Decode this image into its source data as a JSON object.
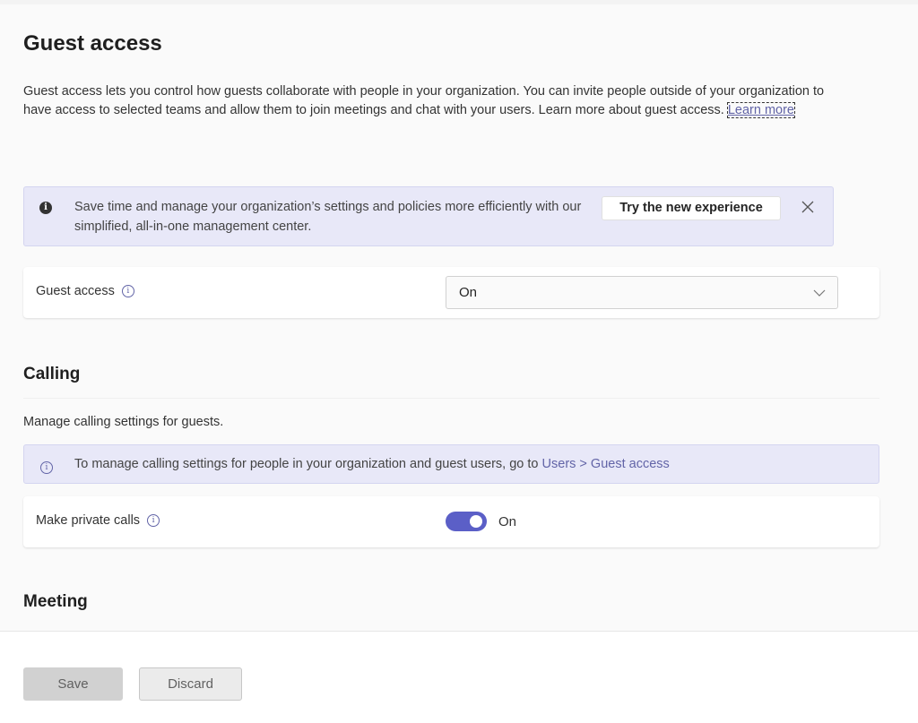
{
  "page": {
    "title": "Guest access",
    "intro_text": "Guest access lets you control how guests collaborate with people in your organization. You can invite people outside of your organization to have access to selected teams and allow them to join meetings and chat with your users. Learn more about guest access. ",
    "intro_link": "Learn more"
  },
  "banner": {
    "icon": "info-solid-icon",
    "message": "Save time and manage your organization’s settings and policies more efficiently with our simplified, all-in-one management center.",
    "button_label": "Try the new experience",
    "close_icon": "close-icon"
  },
  "guest_access": {
    "label": "Guest access",
    "info_icon": "info-outline-icon",
    "selected": "On"
  },
  "calling": {
    "title": "Calling",
    "description": "Manage calling settings for guests.",
    "info_text": "To manage calling settings for people in your organization and guest users, go to ",
    "info_link": "Users > Guest access",
    "setting": {
      "label": "Make private calls",
      "state_label": "On",
      "enabled": true
    }
  },
  "meeting": {
    "title": "Meeting"
  },
  "footer": {
    "save_label": "Save",
    "discard_label": "Discard"
  },
  "colors": {
    "accent": "#5b5fc7",
    "link": "#6264a7",
    "banner_bg": "#e8e8f8"
  }
}
